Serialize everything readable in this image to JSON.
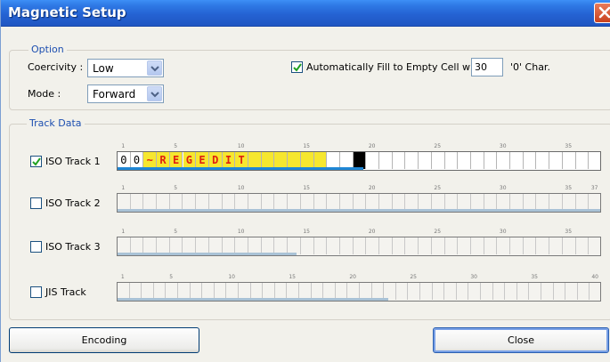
{
  "window": {
    "title": "Magnetic Setup"
  },
  "option": {
    "legend": "Option",
    "coercivity_label": "Coercivity :",
    "coercivity_value": "Low",
    "mode_label": "Mode :",
    "mode_value": "Forward",
    "autofill_checked": true,
    "autofill_label": "Automatically Fill to Empty Cell with",
    "autofill_value": "30",
    "autofill_suffix": "'0'  Char."
  },
  "track_data": {
    "legend": "Track Data",
    "tracks": [
      {
        "label": "ISO Track 1",
        "checked": true,
        "cells": 37,
        "ticks": [
          "1",
          "5",
          "10",
          "15",
          "20",
          "25",
          "30",
          "35"
        ],
        "content": [
          "0",
          "0",
          "~",
          "R",
          "E",
          "G",
          "E",
          "D",
          "I",
          "T"
        ],
        "filled_count": 16,
        "black_index": 18,
        "progress_fraction": 0.51,
        "progress_color": "#1f87d6"
      },
      {
        "label": "ISO Track 2",
        "checked": false,
        "cells": 37,
        "ticks": [
          "1",
          "5",
          "10",
          "15",
          "20",
          "25",
          "30",
          "35",
          "37"
        ],
        "content": [],
        "progress_fraction": 1.0,
        "progress_color": "#a9c2d6"
      },
      {
        "label": "ISO Track 3",
        "checked": false,
        "cells": 37,
        "ticks": [
          "1",
          "5",
          "10",
          "15",
          "20",
          "25",
          "30",
          "35"
        ],
        "content": [],
        "progress_fraction": 0.37,
        "progress_color": "#a9c2d6"
      },
      {
        "label": "JIS Track",
        "checked": false,
        "cells": 40,
        "ticks": [
          "1",
          "5",
          "10",
          "15",
          "20",
          "25",
          "30",
          "35",
          "40"
        ],
        "content": [],
        "progress_fraction": 0.56,
        "progress_color": "#a9c2d6"
      }
    ]
  },
  "buttons": {
    "encoding": "Encoding",
    "close": "Close"
  }
}
